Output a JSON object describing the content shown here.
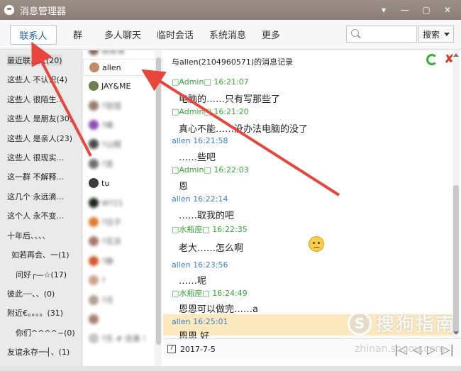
{
  "window": {
    "title": "消息管理器",
    "controls": [
      "▾",
      "—",
      "▢",
      "✕"
    ]
  },
  "toolbar": {
    "tabs": [
      "联系人",
      "群",
      "多人聊天",
      "临时会话",
      "系统消息",
      "更多"
    ],
    "search_placeholder": "",
    "search_button": "搜索"
  },
  "groups": [
    "最近联系人(20)",
    "这些人  不认识(4)",
    "这些人  很陌生...",
    "这些人  是朋友(30)",
    "这些人  是亲人(23)",
    "这些人  很现实...",
    "这一群  不解释...",
    "这几个  永远滴...",
    "这个人  永不变...",
    "十年后、、、、",
    "如若再会、一(1)",
    "问好┌—☆(17)",
    "彼此┈┈、、(0)",
    "附近€。。。。(31)",
    "你们^^^^~(0)",
    "友谊永存一┤、(1)"
  ],
  "contacts": [
    {
      "name": "allen",
      "selected": true
    },
    {
      "name": "JAY&ME",
      "selected": false
    },
    {
      "name": "?验馆",
      "selected": false
    },
    {
      "name": "?峰",
      "selected": false
    },
    {
      "name": "?山贼",
      "selected": false
    },
    {
      "name": "?首",
      "selected": false
    },
    {
      "name": "tu",
      "selected": false
    },
    {
      "name": "W?21",
      "selected": false
    },
    {
      "name": "?日子",
      "selected": false
    },
    {
      "name": "?花凉",
      "selected": false
    },
    {
      "name": "?静",
      "selected": false
    },
    {
      "name": "?",
      "selected": false
    },
    {
      "name": "?月",
      "selected": false
    },
    {
      "name": "",
      "selected": false
    },
    {
      "name": "?乐 # 佳美 !",
      "selected": false
    }
  ],
  "history": {
    "title": "与allen(2104960571)的消息记录",
    "messages": [
      {
        "sender": "□Admin□",
        "time": "16:21:07",
        "kind": "admin",
        "text": "电脑的……只有写那些了"
      },
      {
        "sender": "□Admin□",
        "time": "16:21:20",
        "kind": "admin",
        "text": "真心不能……没办法电脑的没了"
      },
      {
        "sender": "allen",
        "time": "16:21:58",
        "kind": "allen",
        "text": "……些吧"
      },
      {
        "sender": "□Admin□",
        "time": "16:22:03",
        "kind": "admin",
        "text": "恩"
      },
      {
        "sender": "allen",
        "time": "16:22:14",
        "kind": "allen",
        "text": "……取我的吧"
      },
      {
        "sender": "□水瓶座□",
        "time": "16:22:35",
        "kind": "shui",
        "text": "老大……怎么啊"
      },
      {
        "sender": "allen",
        "time": "16:23:56",
        "kind": "allen",
        "text": "……呢"
      },
      {
        "sender": "□水瓶座□",
        "time": "16:24:49",
        "kind": "shui",
        "text": "恩恩可以做完……a"
      },
      {
        "sender": "allen",
        "time": "16:25:01",
        "kind": "allen",
        "text": "恩恩  好"
      }
    ]
  },
  "datebar": {
    "date": "2017-7-5",
    "pager": [
      "|◁",
      "◁",
      "▷",
      "▷|"
    ]
  },
  "watermark": {
    "logo": "S",
    "text": "搜狗指南",
    "url": "zhinan.sogou.com"
  },
  "colors": {
    "accent": "#1a5fa8",
    "admin": "#35a838",
    "allen": "#3a7fd0",
    "highlight": "#fbe9bd",
    "arrow": "#e8453c"
  }
}
